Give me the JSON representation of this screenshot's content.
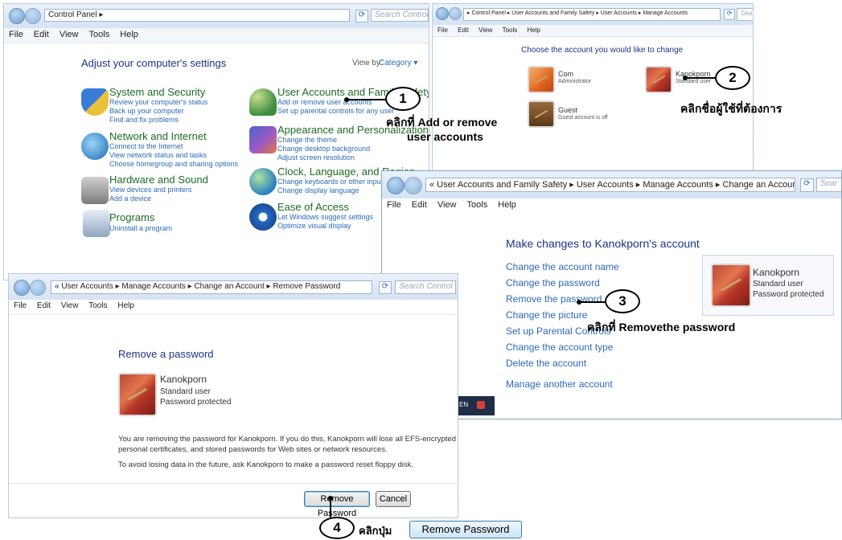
{
  "menu": [
    "File",
    "Edit",
    "View",
    "Tools",
    "Help"
  ],
  "cp": {
    "breadcrumb": "Control Panel ▸",
    "search": "Search Control Panel",
    "heading": "Adjust your computer's settings",
    "viewby_label": "View by:",
    "viewby_value": "Category ▾",
    "categories": [
      {
        "title": "System and Security",
        "links": [
          "Review your computer's status",
          "Back up your computer",
          "Find and fix problems"
        ]
      },
      {
        "title": "Network and Internet",
        "links": [
          "Connect to the Internet",
          "View network status and tasks",
          "Choose homegroup and sharing options"
        ]
      },
      {
        "title": "Hardware and Sound",
        "links": [
          "View devices and printers",
          "Add a device"
        ]
      },
      {
        "title": "Programs",
        "links": [
          "Uninstall a program"
        ]
      },
      {
        "title": "User Accounts and Family Safety",
        "links": [
          "Add or remove user accounts",
          "Set up parental controls for any user"
        ]
      },
      {
        "title": "Appearance and Personalization",
        "links": [
          "Change the theme",
          "Change desktop background",
          "Adjust screen resolution"
        ]
      },
      {
        "title": "Clock, Language, and Region",
        "links": [
          "Change keyboards or other input methods",
          "Change display language"
        ]
      },
      {
        "title": "Ease of Access",
        "links": [
          "Let Windows suggest settings",
          "Optimize visual display"
        ]
      }
    ]
  },
  "manage": {
    "breadcrumb": "▸ Control Panel ▸ User Accounts and Family Safety ▸ User Accounts ▸ Manage Accounts",
    "search": "Sea",
    "heading": "Choose the account you would like to change",
    "accounts": [
      {
        "name": "Com",
        "type": "Administrator"
      },
      {
        "name": "Kanokporn",
        "type": "Standard user"
      },
      {
        "name": "Guest",
        "type": "Guest account is off"
      }
    ]
  },
  "change": {
    "breadcrumb": "« User Accounts and Family Safety ▸ User Accounts ▸ Manage Accounts ▸ Change an Account",
    "search": "Sear",
    "heading": "Make changes to Kanokporn's account",
    "links": [
      "Change the account name",
      "Change the password",
      "Remove the password",
      "Change the picture",
      "Set up Parental Controls",
      "Change the account type",
      "Delete the account",
      "Manage another account"
    ],
    "account_name": "Kanokporn",
    "account_type": "Standard user",
    "account_status": "Password protected",
    "taskbar_text": "EN"
  },
  "remove": {
    "breadcrumb": "« User Accounts ▸ Manage Accounts ▸ Change an Account ▸ Remove Password",
    "search": "Search Control Panel",
    "heading": "Remove a password",
    "account_name": "Kanokporn",
    "account_type": "Standard user",
    "account_status": "Password protected",
    "warning1": "You are removing the password for Kanokporn.  If you do this, Kanokporn will lose all EFS-encrypted files,",
    "warning2": "personal certificates, and stored passwords for Web sites or network resources.",
    "warning3": "To avoid losing data in the future, ask Kanokporn to make a password reset floppy disk.",
    "remove_btn": "Remove Password",
    "cancel_btn": "Cancel"
  },
  "callouts": {
    "c1": "1",
    "c2": "2",
    "c3": "3",
    "c4": "4",
    "t1a": "คลิกที่ Add or remove",
    "t1b": "user accounts",
    "t2": "คลิกชื่อผู้ใช้ที่ต้องการ",
    "t3": "คลิกที่ Removethe password",
    "t4": "คลิกปุ่ม",
    "btn_sample": "Remove Password"
  }
}
